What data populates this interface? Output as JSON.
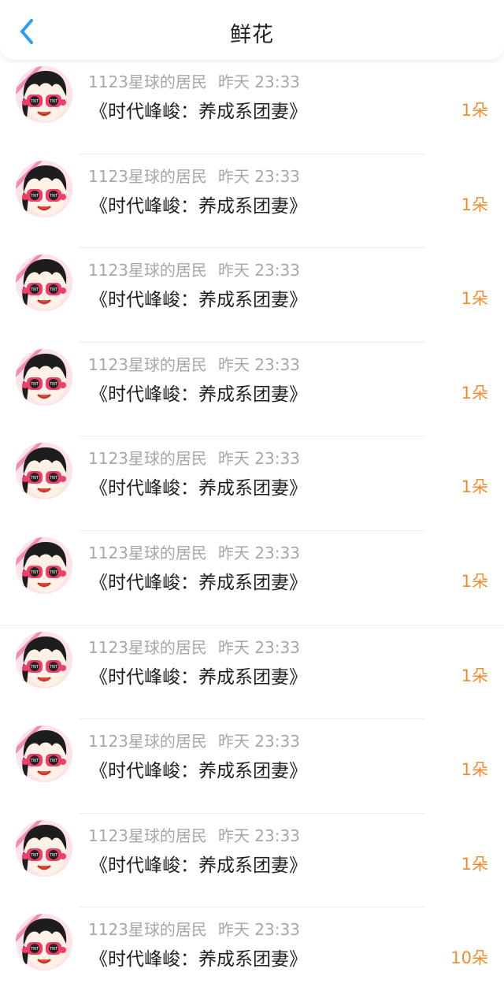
{
  "header": {
    "title": "鲜花",
    "back_icon": "chevron-left-icon",
    "accent": "#2a9df4"
  },
  "colors": {
    "count": "#ef8d2f",
    "meta": "#a7a7a7"
  },
  "items": [
    {
      "user": "1123星球的居民",
      "time": "昨天 23:33",
      "book": "《时代峰峻：养成系团妻》",
      "count": "1朵"
    },
    {
      "user": "1123星球的居民",
      "time": "昨天 23:33",
      "book": "《时代峰峻：养成系团妻》",
      "count": "1朵"
    },
    {
      "user": "1123星球的居民",
      "time": "昨天 23:33",
      "book": "《时代峰峻：养成系团妻》",
      "count": "1朵"
    },
    {
      "user": "1123星球的居民",
      "time": "昨天 23:33",
      "book": "《时代峰峻：养成系团妻》",
      "count": "1朵"
    },
    {
      "user": "1123星球的居民",
      "time": "昨天 23:33",
      "book": "《时代峰峻：养成系团妻》",
      "count": "1朵"
    },
    {
      "user": "1123星球的居民",
      "time": "昨天 23:33",
      "book": "《时代峰峻：养成系团妻》",
      "count": "1朵"
    },
    {
      "user": "1123星球的居民",
      "time": "昨天 23:33",
      "book": "《时代峰峻：养成系团妻》",
      "count": "1朵"
    },
    {
      "user": "1123星球的居民",
      "time": "昨天 23:33",
      "book": "《时代峰峻：养成系团妻》",
      "count": "1朵"
    },
    {
      "user": "1123星球的居民",
      "time": "昨天 23:33",
      "book": "《时代峰峻：养成系团妻》",
      "count": "1朵"
    },
    {
      "user": "1123星球的居民",
      "time": "昨天 23:33",
      "book": "《时代峰峻：养成系团妻》",
      "count": "10朵"
    }
  ]
}
